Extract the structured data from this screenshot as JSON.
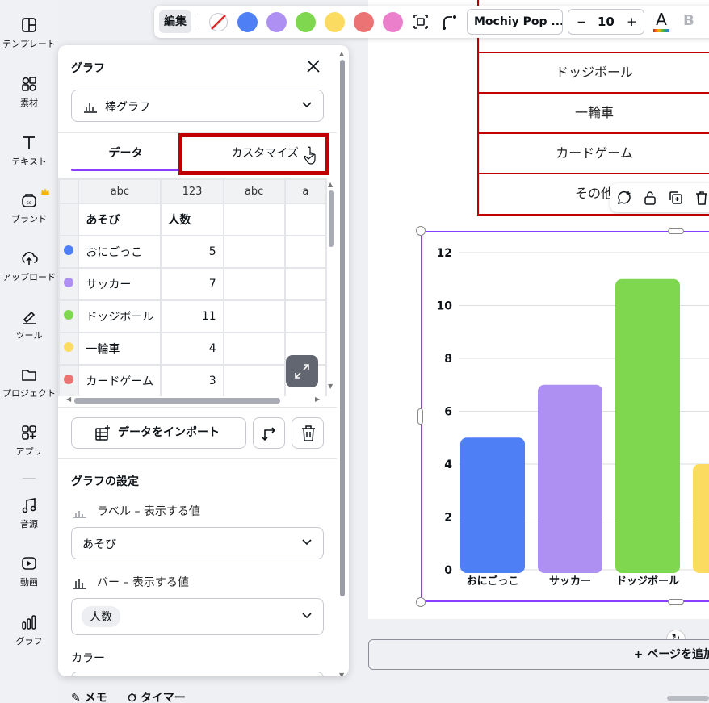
{
  "rail": {
    "items": [
      {
        "label": "テンプレート",
        "icon": "template-icon"
      },
      {
        "label": "素材",
        "icon": "elements-icon"
      },
      {
        "label": "テキスト",
        "icon": "text-icon"
      },
      {
        "label": "ブランド",
        "icon": "brand-icon"
      },
      {
        "label": "アップロード",
        "icon": "upload-icon"
      },
      {
        "label": "ツール",
        "icon": "tools-icon"
      },
      {
        "label": "プロジェクト",
        "icon": "folder-icon"
      },
      {
        "label": "アプリ",
        "icon": "apps-icon"
      },
      {
        "label": "音源",
        "icon": "music-icon"
      },
      {
        "label": "動画",
        "icon": "video-icon"
      },
      {
        "label": "グラフ",
        "icon": "chart-icon"
      }
    ]
  },
  "toolbar": {
    "edit_label": "編集",
    "swatches": [
      "#4f7ff5",
      "#ae8ff2",
      "#7fd64f",
      "#fbdc60",
      "#ec7373",
      "#ec7fcb"
    ],
    "font_name": "Mochiy Pop ...",
    "font_size": "10",
    "minus": "−",
    "plus": "+",
    "text_color_glyph": "A",
    "bold_glyph": "B"
  },
  "panel": {
    "title": "グラフ",
    "chart_type": "棒グラフ",
    "tabs": [
      "データ",
      "カスタマイズ"
    ],
    "grid": {
      "col_types": [
        "abc",
        "123",
        "abc",
        "a"
      ],
      "headers": [
        "あそび",
        "人数"
      ],
      "rows": [
        {
          "color": "#4f7ff5",
          "name": "おにごっこ",
          "value": "5"
        },
        {
          "color": "#ae8ff2",
          "name": "サッカー",
          "value": "7"
        },
        {
          "color": "#7fd64f",
          "name": "ドッジボール",
          "value": "11"
        },
        {
          "color": "#fbdc60",
          "name": "一輪車",
          "value": "4"
        },
        {
          "color": "#ec7373",
          "name": "カードゲーム",
          "value": "3"
        }
      ]
    },
    "import_label": "データをインポート",
    "settings_title": "グラフの設定",
    "label_field": "ラベル – 表示する値",
    "label_value": "あそび",
    "bar_field": "バー – 表示する値",
    "bar_value": "人数",
    "color_label": "カラー"
  },
  "page_table": {
    "rows": [
      "ドッジボール",
      "一輪車",
      "カードゲーム",
      "その他"
    ]
  },
  "chart_data": {
    "type": "bar",
    "categories": [
      "おにごっこ",
      "サッカー",
      "ドッジボール",
      "一輪車"
    ],
    "values": [
      5,
      7,
      11,
      4
    ],
    "colors": [
      "#4f7ff5",
      "#ae8ff2",
      "#7fd64f",
      "#fbdc60"
    ],
    "yticks": [
      "0",
      "2",
      "4",
      "6",
      "8",
      "10",
      "12"
    ],
    "ylim": [
      0,
      12
    ],
    "grid": true
  },
  "canvas": {
    "add_page_label": "+ ページを追加"
  },
  "bottom": {
    "memo_label": "メモ",
    "timer_label": "タイマー"
  }
}
